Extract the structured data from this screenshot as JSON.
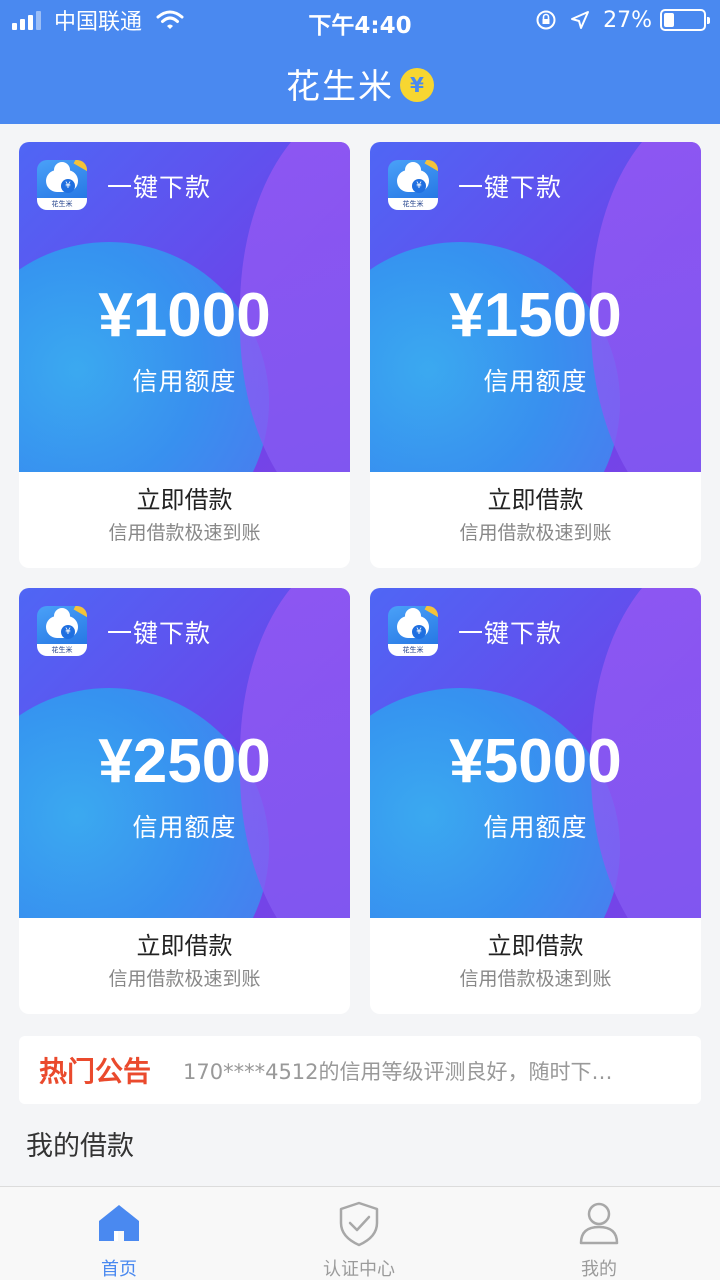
{
  "status_bar": {
    "carrier": "中国联通",
    "time": "下午4:40",
    "battery_percent": "27%"
  },
  "header": {
    "title": "花生米",
    "coin_symbol": "¥"
  },
  "cards": [
    {
      "tag": "一键下款",
      "logo_text": "花生米",
      "amount": "¥1000",
      "amount_label": "信用额度",
      "action": "立即借款",
      "subtitle": "信用借款极速到账"
    },
    {
      "tag": "一键下款",
      "logo_text": "花生米",
      "amount": "¥1500",
      "amount_label": "信用额度",
      "action": "立即借款",
      "subtitle": "信用借款极速到账"
    },
    {
      "tag": "一键下款",
      "logo_text": "花生米",
      "amount": "¥2500",
      "amount_label": "信用额度",
      "action": "立即借款",
      "subtitle": "信用借款极速到账"
    },
    {
      "tag": "一键下款",
      "logo_text": "花生米",
      "amount": "¥5000",
      "amount_label": "信用额度",
      "action": "立即借款",
      "subtitle": "信用借款极速到账"
    }
  ],
  "notice": {
    "title": "热门公告",
    "text": "170****4512的信用等级评测良好，随时下…"
  },
  "my_loans": {
    "title": "我的借款"
  },
  "tabbar": {
    "active_color": "#4a89f0",
    "items": [
      {
        "label": "首页",
        "icon": "home-icon",
        "active": true
      },
      {
        "label": "认证中心",
        "icon": "shield-check-icon",
        "active": false
      },
      {
        "label": "我的",
        "icon": "user-icon",
        "active": false
      }
    ]
  }
}
